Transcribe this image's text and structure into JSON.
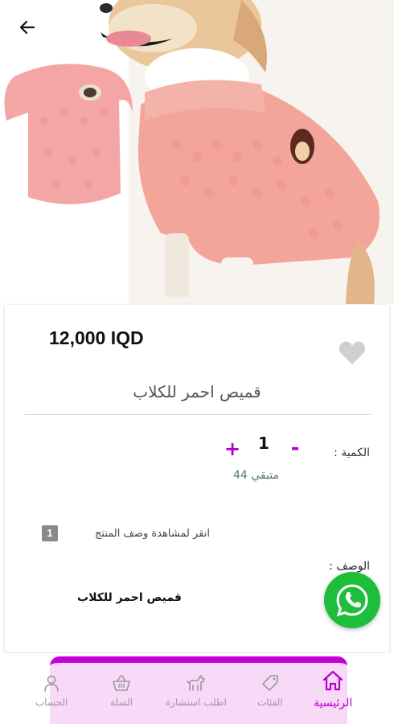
{
  "product": {
    "price": "12,000 IQD",
    "title": "قميص احمر للكلاب",
    "quantity_label": "الكمية :",
    "quantity_value": "1",
    "minus": "-",
    "plus": "+",
    "remaining": "متبقي 44",
    "description_link_badge": "1",
    "description_link": "انقر لمشاهدة وصف المنتج",
    "description_label": "الوصف :",
    "description_text": "قميص احمر للكلاب"
  },
  "colors": {
    "accent": "#b400c8",
    "whatsapp": "#1ebe3c",
    "sweater": "#f4a59a"
  },
  "bottom_nav": {
    "items": [
      {
        "label": "الرئيسية",
        "icon": "home-icon",
        "active": true
      },
      {
        "label": "الفئات",
        "icon": "tag-icon",
        "active": false
      },
      {
        "label": "اطلب استشارة",
        "icon": "dog-icon",
        "active": false
      },
      {
        "label": "السلة",
        "icon": "basket-icon",
        "active": false
      },
      {
        "label": "الحساب",
        "icon": "user-icon",
        "active": false
      }
    ]
  }
}
